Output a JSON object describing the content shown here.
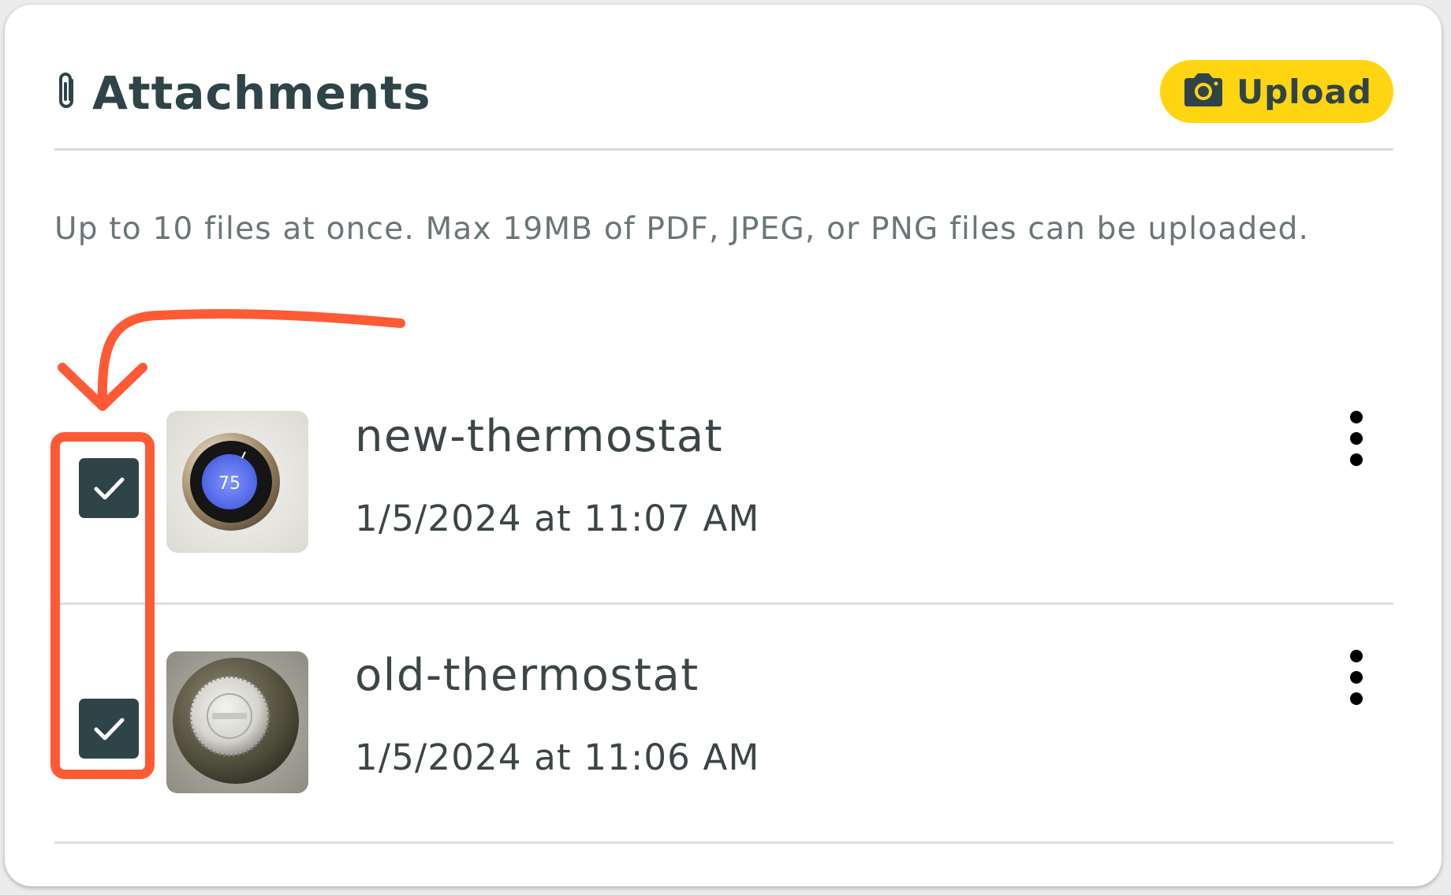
{
  "header": {
    "title": "Attachments",
    "upload_label": "Upload"
  },
  "helper_text": "Up to 10 files at once. Max 19MB of PDF, JPEG, or PNG files can be uploaded.",
  "attachments": [
    {
      "name": "new-thermostat",
      "date": "1/5/2024 at 11:07 AM",
      "checked": true,
      "thumb_text": "75"
    },
    {
      "name": "old-thermostat",
      "date": "1/5/2024 at 11:06 AM",
      "checked": true
    }
  ],
  "colors": {
    "brand_dark": "#2f4448",
    "accent_yellow": "#ffd511",
    "annotation_red": "#ff5a36"
  },
  "icons": {
    "title": "paperclip-icon",
    "upload": "camera-icon",
    "row_menu": "more-vertical-icon",
    "checkbox": "checkmark-icon"
  }
}
